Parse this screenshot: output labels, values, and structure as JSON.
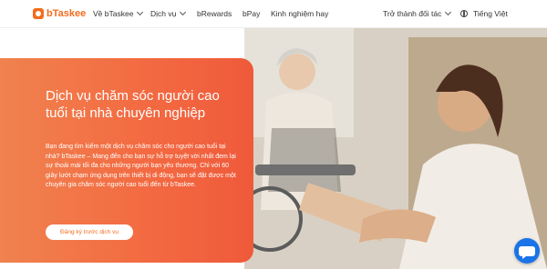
{
  "brand": {
    "logo_text": "bTaskee",
    "accent": "#f26c1e"
  },
  "nav": {
    "items": [
      {
        "label": "Về bTaskee",
        "has_dropdown": true
      },
      {
        "label": "Dịch vụ",
        "has_dropdown": true
      },
      {
        "label": "bRewards",
        "has_dropdown": false
      },
      {
        "label": "bPay",
        "has_dropdown": false
      },
      {
        "label": "Kinh nghiệm hay",
        "has_dropdown": false
      }
    ],
    "partner_label": "Trở thành đối tác",
    "language_label": "Tiếng Việt"
  },
  "hero": {
    "title": "Dịch vụ chăm sóc người cao tuổi tại nhà chuyên nghiệp",
    "description": "Bạn đang tìm kiếm một dịch vụ chăm sóc cho người cao tuổi tại nhà? bTaskee – Mang đến cho bạn sự hỗ trợ tuyệt vời nhất đem lại sự thoải mái tối đa cho những người bạn yêu thương. Chỉ với 60 giây lướt chạm ứng dụng trên thiết bị di động, bạn sẽ đặt được một chuyên gia chăm sóc người cao tuổi đến từ bTaskee.",
    "cta_label": "Đăng ký trước dịch vụ"
  },
  "icons": {
    "logo": "btaskee-logo-icon",
    "language": "globe-icon",
    "chat": "chat-bubble-icon"
  }
}
